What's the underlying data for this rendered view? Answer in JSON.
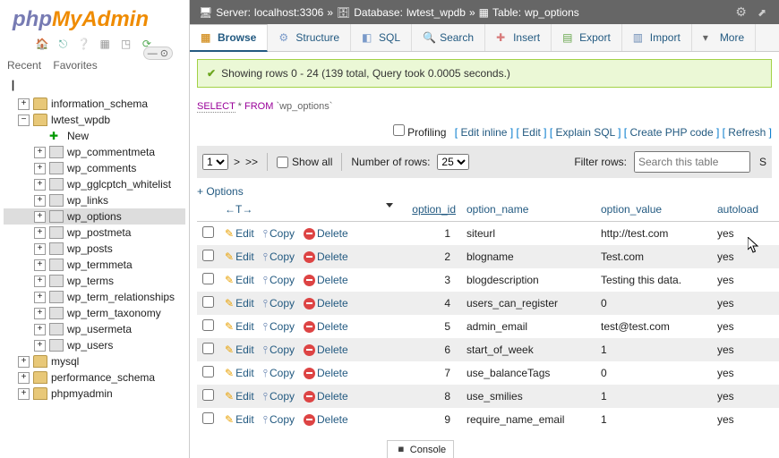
{
  "logo": {
    "php": "php",
    "my": "My",
    "admin": "Admin"
  },
  "sidebarTabs": {
    "recent": "Recent",
    "favorites": "Favorites"
  },
  "tree": [
    {
      "indent": 0,
      "toggle": "bar",
      "icon": "",
      "label": "",
      "selected": false
    },
    {
      "indent": 12,
      "toggle": "+",
      "icon": "db",
      "label": "information_schema",
      "selected": false
    },
    {
      "indent": 12,
      "toggle": "-",
      "icon": "db",
      "label": "lwtest_wpdb",
      "selected": false
    },
    {
      "indent": 30,
      "toggle": "none",
      "icon": "new",
      "label": "New",
      "selected": false
    },
    {
      "indent": 30,
      "toggle": "+",
      "icon": "tbl",
      "label": "wp_commentmeta",
      "selected": false
    },
    {
      "indent": 30,
      "toggle": "+",
      "icon": "tbl",
      "label": "wp_comments",
      "selected": false
    },
    {
      "indent": 30,
      "toggle": "+",
      "icon": "tbl",
      "label": "wp_gglcptch_whitelist",
      "selected": false
    },
    {
      "indent": 30,
      "toggle": "+",
      "icon": "tbl",
      "label": "wp_links",
      "selected": false
    },
    {
      "indent": 30,
      "toggle": "+",
      "icon": "tbl",
      "label": "wp_options",
      "selected": true
    },
    {
      "indent": 30,
      "toggle": "+",
      "icon": "tbl",
      "label": "wp_postmeta",
      "selected": false
    },
    {
      "indent": 30,
      "toggle": "+",
      "icon": "tbl",
      "label": "wp_posts",
      "selected": false
    },
    {
      "indent": 30,
      "toggle": "+",
      "icon": "tbl",
      "label": "wp_termmeta",
      "selected": false
    },
    {
      "indent": 30,
      "toggle": "+",
      "icon": "tbl",
      "label": "wp_terms",
      "selected": false
    },
    {
      "indent": 30,
      "toggle": "+",
      "icon": "tbl",
      "label": "wp_term_relationships",
      "selected": false
    },
    {
      "indent": 30,
      "toggle": "+",
      "icon": "tbl",
      "label": "wp_term_taxonomy",
      "selected": false
    },
    {
      "indent": 30,
      "toggle": "+",
      "icon": "tbl",
      "label": "wp_usermeta",
      "selected": false
    },
    {
      "indent": 30,
      "toggle": "+",
      "icon": "tbl",
      "label": "wp_users",
      "selected": false
    },
    {
      "indent": 12,
      "toggle": "+",
      "icon": "db",
      "label": "mysql",
      "selected": false
    },
    {
      "indent": 12,
      "toggle": "+",
      "icon": "db",
      "label": "performance_schema",
      "selected": false
    },
    {
      "indent": 12,
      "toggle": "+",
      "icon": "db",
      "label": "phpmyadmin",
      "selected": false
    }
  ],
  "breadcrumb": {
    "server_label": "Server:",
    "server_val": "localhost:3306",
    "sep": "»",
    "db_label": "Database:",
    "db_val": "lwtest_wpdb",
    "tbl_label": "Table:",
    "tbl_val": "wp_options"
  },
  "navTabs": [
    {
      "label": "Browse",
      "active": true
    },
    {
      "label": "Structure",
      "active": false
    },
    {
      "label": "SQL",
      "active": false
    },
    {
      "label": "Search",
      "active": false
    },
    {
      "label": "Insert",
      "active": false
    },
    {
      "label": "Export",
      "active": false
    },
    {
      "label": "Import",
      "active": false
    },
    {
      "label": "More",
      "active": false
    }
  ],
  "successMsg": "Showing rows 0 - 24 (139 total, Query took 0.0005 seconds.)",
  "sql": {
    "select": "SELECT",
    "star": " * ",
    "from": "FROM",
    "tbl": " `wp_options`"
  },
  "actionBar": {
    "profiling": "Profiling",
    "editInline": "Edit inline",
    "edit": "Edit",
    "explain": "Explain SQL",
    "php": "Create PHP code",
    "refresh": "Refresh"
  },
  "navRow": {
    "page": "1",
    "next": ">",
    "last": ">>",
    "showAll": "Show all",
    "numRowsLabel": "Number of rows:",
    "numRows": "25",
    "filterLabel": "Filter rows:",
    "filterPlaceholder": "Search this table"
  },
  "optionsLink": "+ Options",
  "headerExtra": "←T→",
  "columns": [
    "option_id",
    "option_name",
    "option_value",
    "autoload"
  ],
  "rowActions": {
    "edit": "Edit",
    "copy": "Copy",
    "delete": "Delete"
  },
  "rows": [
    {
      "id": "1",
      "name": "siteurl",
      "value": "http://test.com",
      "autoload": "yes"
    },
    {
      "id": "2",
      "name": "blogname",
      "value": "Test.com",
      "autoload": "yes"
    },
    {
      "id": "3",
      "name": "blogdescription",
      "value": "Testing this data.",
      "autoload": "yes"
    },
    {
      "id": "4",
      "name": "users_can_register",
      "value": "0",
      "autoload": "yes"
    },
    {
      "id": "5",
      "name": "admin_email",
      "value": "test@test.com",
      "autoload": "yes"
    },
    {
      "id": "6",
      "name": "start_of_week",
      "value": "1",
      "autoload": "yes"
    },
    {
      "id": "7",
      "name": "use_balanceTags",
      "value": "0",
      "autoload": "yes"
    },
    {
      "id": "8",
      "name": "use_smilies",
      "value": "1",
      "autoload": "yes"
    },
    {
      "id": "9",
      "name": "require_name_email",
      "value": "1",
      "autoload": "yes"
    }
  ],
  "console": "Console",
  "sortBtn": "S"
}
